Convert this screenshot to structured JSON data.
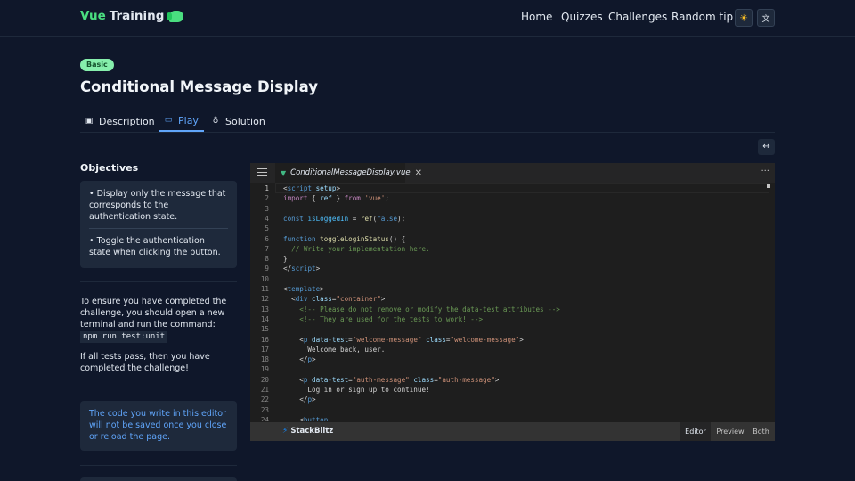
{
  "header": {
    "logo_vue": "Vue",
    "logo_training": "Training",
    "nav": [
      "Home",
      "Quizzes",
      "Challenges",
      "Random tip"
    ],
    "theme_icon": "sun-icon",
    "lang_icon": "translate-icon"
  },
  "challenge": {
    "difficulty": "Basic",
    "title": "Conditional Message Display",
    "tabs": [
      {
        "label": "Description",
        "icon": "book-icon"
      },
      {
        "label": "Play",
        "icon": "gamepad-icon"
      },
      {
        "label": "Solution",
        "icon": "medal-icon"
      }
    ],
    "active_tab": "Play"
  },
  "objectives": {
    "title": "Objectives",
    "items": [
      "Display only the message that corresponds to the authentication state.",
      "Toggle the authentication state when clicking the button."
    ]
  },
  "instructions": {
    "text": "To ensure you have completed the challenge, you should open a new terminal and run the command:",
    "command": "npm run test:unit",
    "pass_text": "If all tests pass, then you have completed the challenge!"
  },
  "note": "The code you write in this editor will not be saved once you close or reload the page.",
  "editor": {
    "filename": "ConditionalMessageDisplay.vue",
    "line_numbers": [
      "1",
      "2",
      "3",
      "4",
      "5",
      "6",
      "7",
      "8",
      "9",
      "10",
      "11",
      "12",
      "13",
      "14",
      "15",
      "16",
      "17",
      "18",
      "19",
      "20",
      "21",
      "22",
      "23",
      "24"
    ],
    "footer_brand": "StackBlitz",
    "views": [
      "Editor",
      "Preview",
      "Both"
    ],
    "active_view": "Editor"
  }
}
